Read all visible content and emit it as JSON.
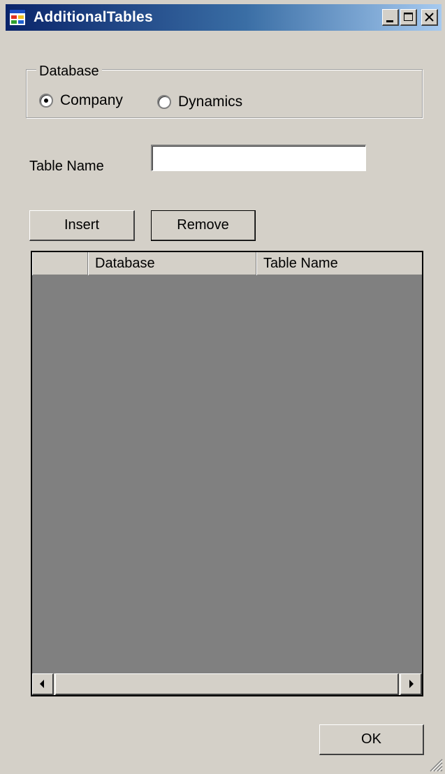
{
  "window": {
    "title": "AdditionalTables",
    "icon": "form-icon",
    "caption_buttons": [
      "minimize-icon",
      "maximize-icon",
      "close-icon"
    ]
  },
  "database_group": {
    "legend": "Database",
    "options": [
      {
        "label": "Company",
        "checked": true
      },
      {
        "label": "Dynamics",
        "checked": false
      }
    ]
  },
  "table_name": {
    "label": "Table Name",
    "value": "",
    "placeholder": ""
  },
  "buttons": {
    "insert": "Insert",
    "remove": "Remove",
    "ok": "OK"
  },
  "grid": {
    "columns": [
      "",
      "Database",
      "Table Name"
    ],
    "rows": []
  }
}
